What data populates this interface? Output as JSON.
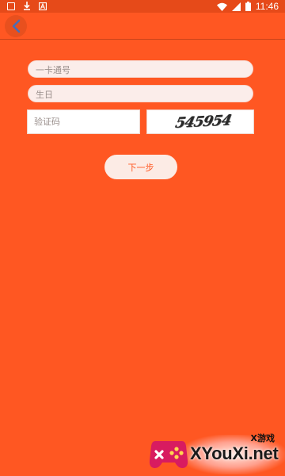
{
  "status_bar": {
    "time": "11:46",
    "left_icons": [
      "image-icon",
      "download-icon",
      "a-icon"
    ],
    "right_icons": [
      "wifi-icon",
      "signal-icon",
      "battery-icon"
    ]
  },
  "header": {
    "back_icon": "chevron-left-icon"
  },
  "form": {
    "card_number_placeholder": "一卡通号",
    "birthday_placeholder": "生日",
    "code_placeholder": "验证码",
    "captcha_text": "545954",
    "next_label": "下一步"
  },
  "watermark": {
    "brand_small": "X游戏",
    "brand": "XYouXi.net"
  },
  "colors": {
    "background": "#FF5722",
    "status_bar": "#E64A19",
    "field_bg": "#FBEDEA",
    "button_text": "#FF5722"
  }
}
